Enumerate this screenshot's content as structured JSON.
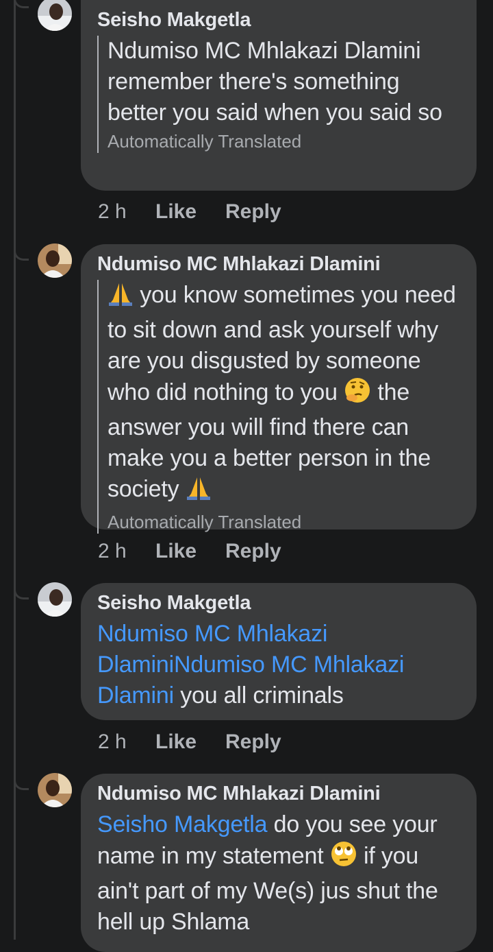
{
  "comments": [
    {
      "author": "Seisho Makgetla",
      "text": "Ndumiso MC Mhlakazi Dlamini remember there's something better you said when you said so",
      "translated_label": "Automatically Translated",
      "time": "2 h",
      "like_label": "Like",
      "reply_label": "Reply"
    },
    {
      "author": "Ndumiso MC Mhlakazi Dlamini",
      "text_parts": [
        "you know sometimes you need to sit down and ask yourself why are you disgusted by someone who did nothing to you",
        "the answer you will find there can make you a better person in the society"
      ],
      "emojis": [
        "pray-emoji",
        "thinking-emoji",
        "pray-emoji"
      ],
      "translated_label": "Automatically Translated",
      "time": "2 h",
      "like_label": "Like",
      "reply_label": "Reply"
    },
    {
      "author": "Seisho Makgetla",
      "mentions": [
        "Ndumiso MC Mhlakazi Dlamini",
        "Ndumiso MC Mhlakazi Dlamini"
      ],
      "text": "you all criminals",
      "time": "2 h",
      "like_label": "Like",
      "reply_label": "Reply"
    },
    {
      "author": "Ndumiso MC Mhlakazi Dlamini",
      "mention": "Seisho Makgetla",
      "text_parts": [
        "do you see your name in my statement",
        "if you ain't part of my We(s)  jus shut the hell up Shlama"
      ],
      "emojis": [
        "eye-roll-emoji"
      ]
    }
  ],
  "colors": {
    "background": "#18191a",
    "bubble": "#3a3b3c",
    "text": "#e4e6eb",
    "mention": "#4599ff",
    "muted": "#b0b3b8"
  }
}
